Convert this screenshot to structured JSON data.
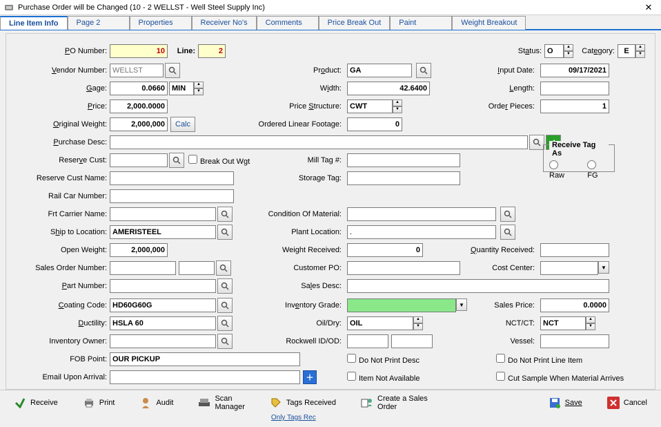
{
  "window": {
    "title": "Purchase Order will be Changed  (10 - 2  WELLST - Well Steel Supply Inc)"
  },
  "tabs": [
    "Line Item Info",
    "Page 2",
    "Properties",
    "Receiver No's",
    "Comments",
    "Price Break Out",
    "Paint",
    "Weight Breakout"
  ],
  "labels": {
    "po_number": "PO Number:",
    "line": "Line:",
    "status": "Status:",
    "category": "Category:",
    "vendor_number": "Vendor Number:",
    "product": "Product:",
    "input_date": "Input Date:",
    "gage": "Gage:",
    "width": "Width:",
    "length": "Length:",
    "price": "Price:",
    "price_structure": "Price Structure:",
    "order_pieces": "Order Pieces:",
    "original_weight": "Original Weight:",
    "calc": "Calc",
    "ordered_linear_footage": "Ordered Linear Footage:",
    "purchase_desc": "Purchase Desc:",
    "reserve_cust": "Reserve Cust:",
    "break_out_wgt": "Break Out Wgt",
    "mill_tag": "Mill Tag #:",
    "receive_tag_as": "Receive Tag As",
    "raw": "Raw",
    "fg": "FG",
    "reserve_cust_name": "Reserve Cust Name:",
    "storage_tag": "Storage Tag:",
    "rail_car_number": "Rail Car Number:",
    "frt_carrier_name": "Frt Carrier Name:",
    "condition_of_material": "Condition Of Material:",
    "ship_to_location": "Ship to Location:",
    "plant_location": "Plant Location:",
    "open_weight": "Open Weight:",
    "weight_received": "Weight Received:",
    "quantity_received": "Quantity Received:",
    "sales_order_number": "Sales Order Number:",
    "customer_po": "Customer PO:",
    "cost_center": "Cost Center:",
    "part_number": "Part Number:",
    "sales_desc": "Sales Desc:",
    "coating_code": "Coating Code:",
    "inventory_grade": "Inventory Grade:",
    "sales_price": "Sales Price:",
    "ductility": "Ductility:",
    "oil_dry": "Oil/Dry:",
    "nct_ct": "NCT/CT:",
    "inventory_owner": "Inventory Owner:",
    "rockwell": "Rockwell ID/OD:",
    "vessel": "Vessel:",
    "fob_point": "FOB Point:",
    "email_upon_arrival": "Email Upon Arrival:",
    "do_not_print_desc": "Do Not Print Desc",
    "item_not_available": "Item Not Available",
    "do_not_print_line_item": "Do Not Print Line Item",
    "cut_sample": "Cut Sample When Material Arrives"
  },
  "values": {
    "po_number": "10",
    "line": "2",
    "status": "O",
    "category": "E",
    "vendor_number": "WELLST",
    "product": "GA",
    "input_date": "09/17/2021",
    "gage": "0.0660",
    "gage_unit": "MIN",
    "width": "42.6400",
    "length": "",
    "price": "2,000.0000",
    "price_structure": "CWT",
    "order_pieces": "1",
    "original_weight": "2,000,000",
    "ordered_linear_footage": "0",
    "purchase_desc": "",
    "reserve_cust": "",
    "mill_tag": "",
    "reserve_cust_name": "",
    "storage_tag": "",
    "rail_car_number": "",
    "frt_carrier_name": "",
    "condition_of_material": "",
    "ship_to_location": "AMERISTEEL",
    "plant_location": ".",
    "open_weight": "2,000,000",
    "weight_received": "0",
    "quantity_received": "",
    "sales_order_number": "",
    "sales_order_number_b": "",
    "customer_po": "",
    "cost_center": "",
    "part_number": "",
    "sales_desc": "",
    "coating_code": "HD60G60G",
    "inventory_grade": "",
    "sales_price": "0.0000",
    "ductility": "HSLA 60",
    "oil_dry": "OIL",
    "nct_ct": "NCT",
    "inventory_owner": "",
    "rockwell_a": "",
    "rockwell_b": "",
    "vessel": "",
    "fob_point": "OUR PICKUP",
    "email_upon_arrival": ""
  },
  "footer": {
    "receive": "Receive",
    "print": "Print",
    "audit": "Audit",
    "scan_manager": "Scan Manager",
    "tags_received": "Tags Received",
    "only_tags_rec": "Only Tags Rec",
    "create_sales_order": "Create a Sales Order",
    "save": "Save",
    "cancel": "Cancel"
  }
}
